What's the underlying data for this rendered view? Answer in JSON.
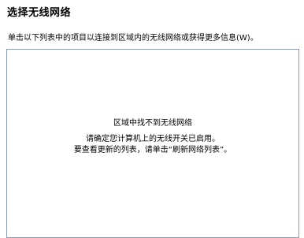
{
  "header": {
    "title": "选择无线网络",
    "description": "单击以下列表中的项目以连接到区域内的无线网络或获得更多信息(W)。"
  },
  "network_list": {
    "empty_title": "区域中找不到无线网络",
    "empty_line_1": "请确定您计算机上的无线开关已启用。",
    "empty_line_2": "要查看更新的列表，请单击“刷新网络列表”。"
  }
}
